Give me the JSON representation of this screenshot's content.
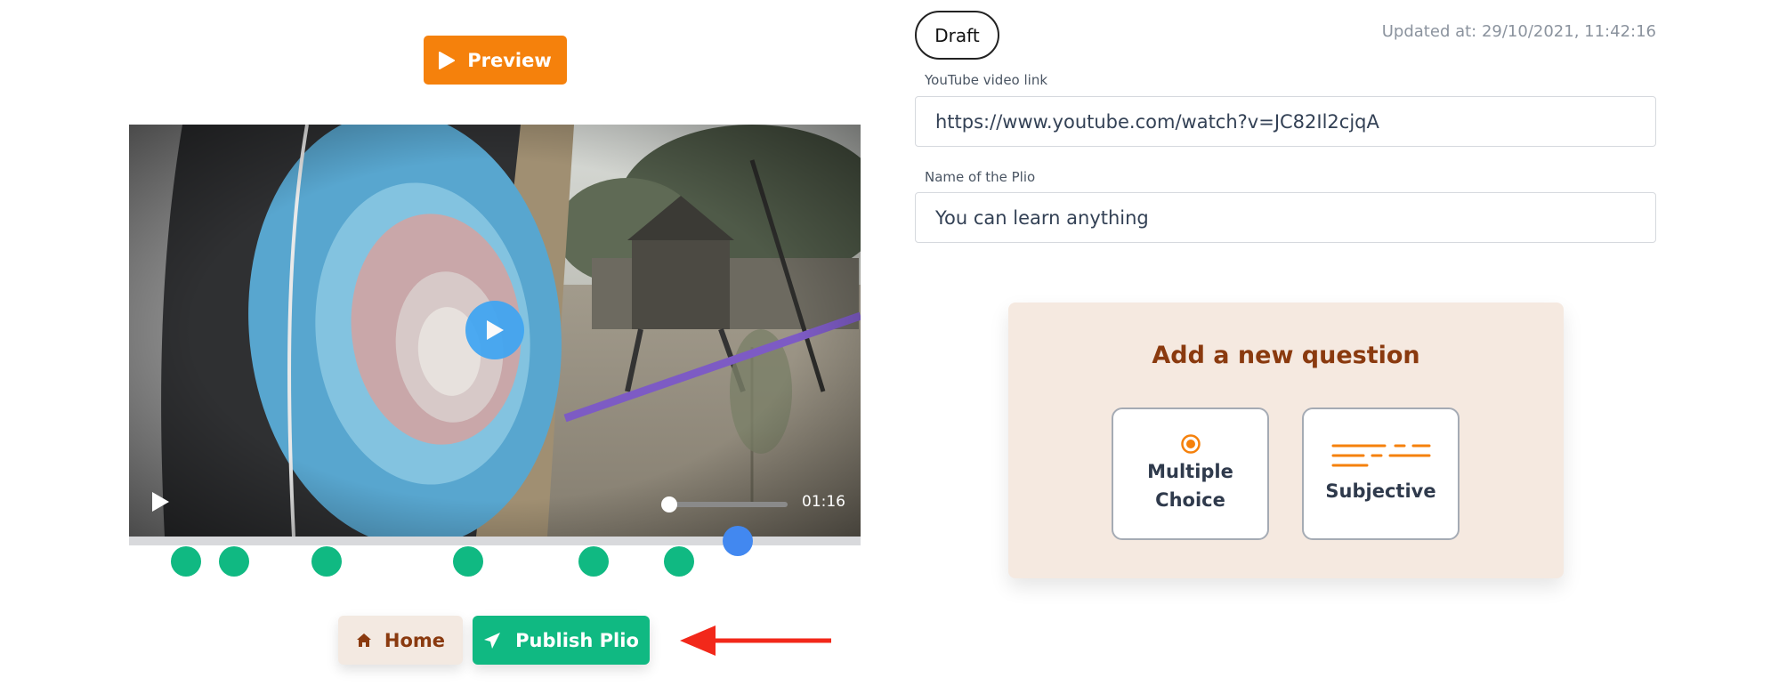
{
  "toolbar": {
    "preview_label": "Preview"
  },
  "player": {
    "time": "01:16",
    "progress_fraction": 0.0
  },
  "timeline": {
    "item_count": 6,
    "playhead_fraction": 0.83
  },
  "actions": {
    "home_label": "Home",
    "publish_label": "Publish Plio"
  },
  "status": {
    "draft_label": "Draft",
    "updated_text": "Updated at: 29/10/2021, 11:42:16"
  },
  "form": {
    "video_link_label": "YouTube video link",
    "video_link_value": "https://www.youtube.com/watch?v=JC82Il2cjqA",
    "name_label": "Name of the Plio",
    "name_value": "You can learn anything"
  },
  "question_panel": {
    "title": "Add a new question",
    "options": [
      {
        "label_line1": "Multiple",
        "label_line2": "Choice",
        "icon": "radio-icon"
      },
      {
        "label": "Subjective",
        "icon": "text-lines-icon"
      }
    ]
  },
  "colors": {
    "accent_orange": "#f5810c",
    "green": "#10b982",
    "playhead_blue": "#4288f0",
    "panel_bg": "#f5e9e0",
    "brown_text": "#8a3a0f",
    "arrow_red": "#f2281a"
  }
}
